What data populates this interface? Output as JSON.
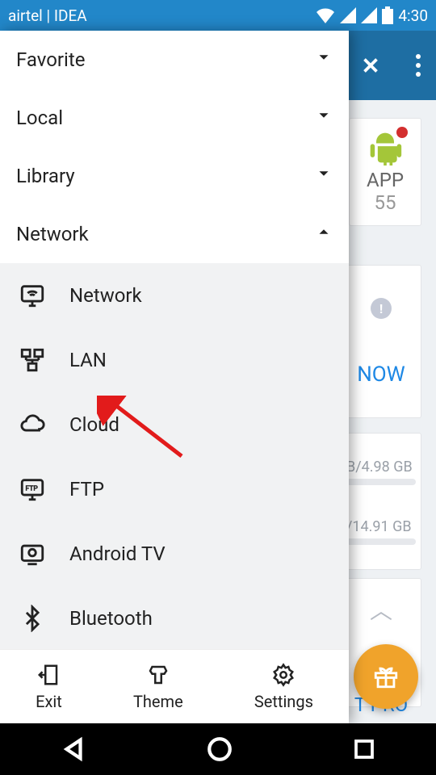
{
  "statusbar": {
    "carrier": "airtel | IDEA",
    "time": "4:30"
  },
  "bg": {
    "app_card": {
      "label": "APP",
      "count": "55"
    },
    "now": "NOW",
    "storage1": {
      "used": "B",
      "total": "/4.98 GB"
    },
    "storage2": {
      "used": "",
      "total": "/14.91 GB"
    },
    "pro": "T PRO"
  },
  "drawer": {
    "sections": {
      "favorite": "Favorite",
      "local": "Local",
      "library": "Library",
      "network": "Network"
    },
    "network_items": {
      "network": "Network",
      "lan": "LAN",
      "cloud": "Cloud",
      "ftp": "FTP",
      "androidtv": "Android TV",
      "bluetooth": "Bluetooth"
    },
    "bottom": {
      "exit": "Exit",
      "theme": "Theme",
      "settings": "Settings"
    }
  }
}
